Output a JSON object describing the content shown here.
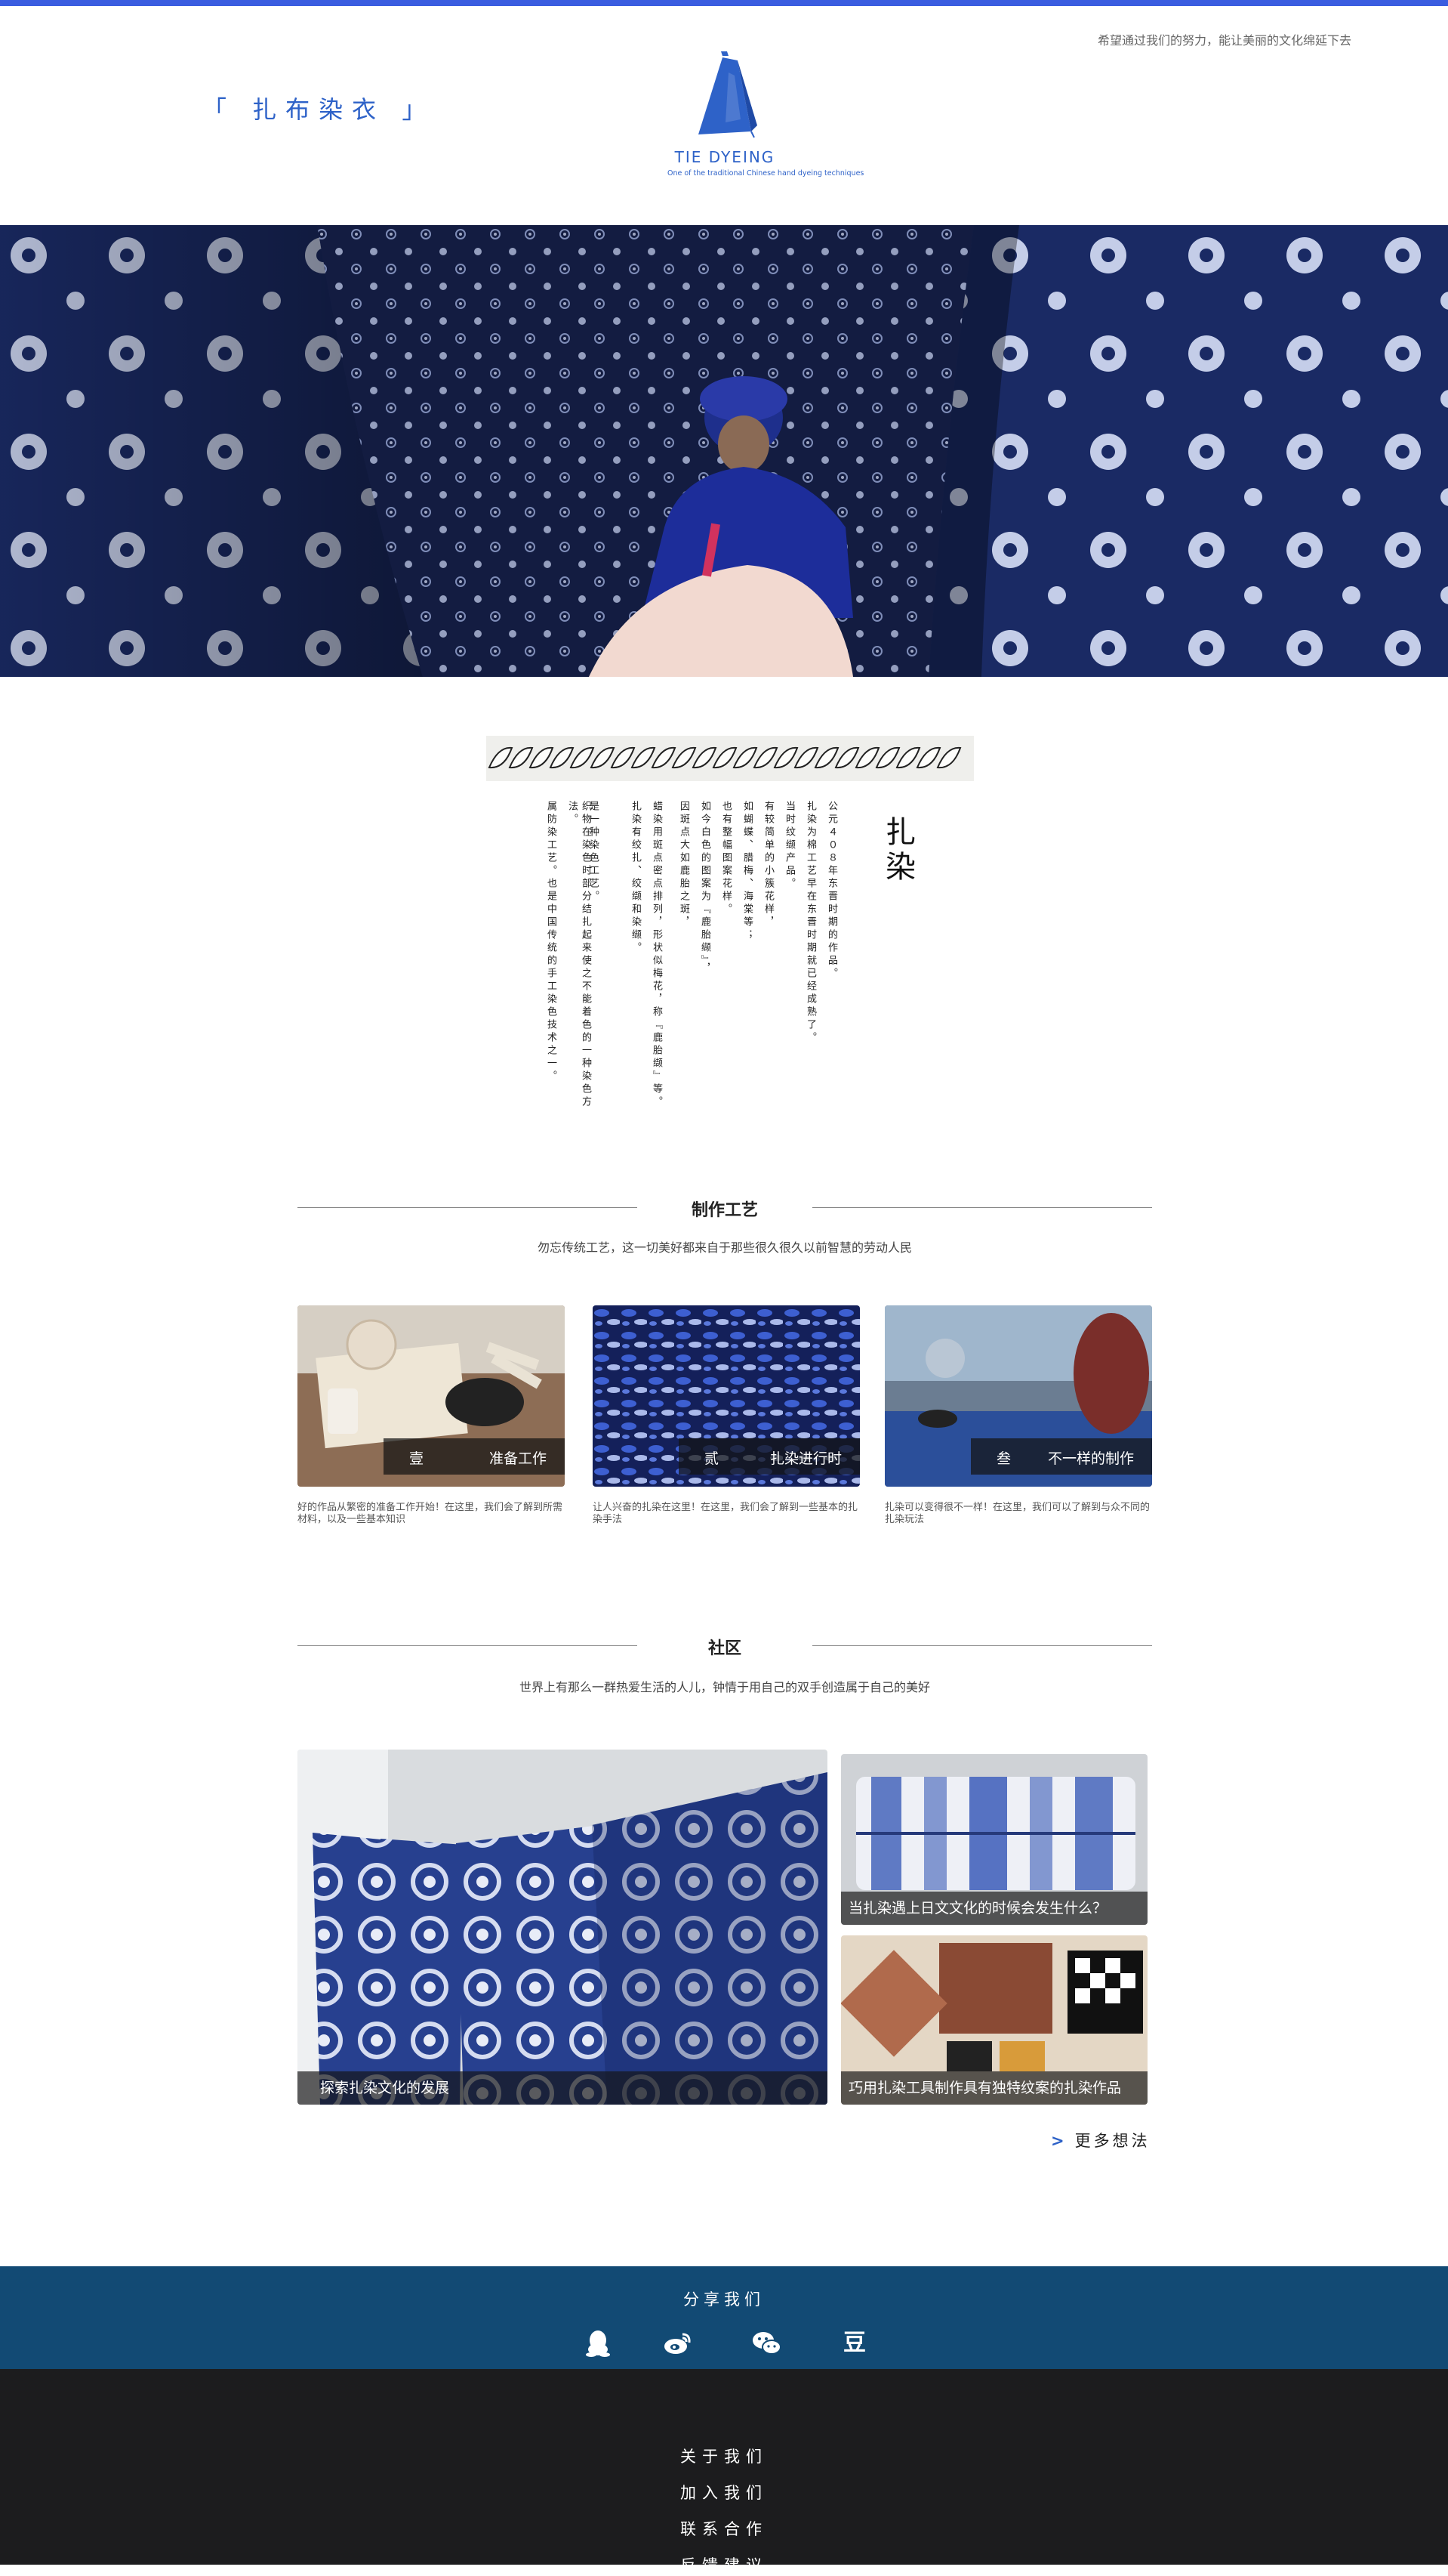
{
  "header": {
    "brand_left": "「 扎布染衣 」",
    "tagline": "希望通过我们的努力，能让美丽的文化绵延下去",
    "logo_title": "TIE DYEING",
    "logo_subtitle": "One of the traditional Chinese hand dyeing techniques",
    "accent_color": "#2e62c8"
  },
  "poem": {
    "title": "扎染",
    "columns": [
      "公元４０８年东晋时期的作品。",
      "扎染为棉工艺早在东晋时期就已经成熟了。",
      "当时纹缬产品。",
      "有较简单的小簇花样，",
      "如蝴蝶、腊梅、海棠等；",
      "也有整幅图案花样。",
      "如今白色的图案为『鹿胎缬』，",
      "因斑点大如鹿胎之斑，",
      "蜡染用斑点密点排列，形状似梅花，称『鹿胎缬』等。",
      "扎染有绞扎、绞缬和染缬。",
      "是一种染色工艺。",
      "织物在染色时部分结扎起来使之不能着色的一种染色方法。",
      "属防染工艺。也是中国传统的手工染色技术之一。"
    ]
  },
  "process": {
    "title": "制作工艺",
    "subtitle": "勿忘传统工艺，这一切美好都来自于那些很久很久以前智慧的劳动人民",
    "cards": [
      {
        "num": "壹",
        "name": "准备工作",
        "desc": "好的作品从繁密的准备工作开始！在这里，我们会了解到所需材料，以及一些基本知识"
      },
      {
        "num": "贰",
        "name": "扎染进行时",
        "desc": "让人兴奋的扎染在这里！在这里，我们会了解到一些基本的扎染手法"
      },
      {
        "num": "叁",
        "name": "不一样的制作",
        "desc": "扎染可以变得很不一样！在这里，我们可以了解到与众不同的扎染玩法"
      }
    ]
  },
  "community": {
    "title": "社区",
    "subtitle": "世界上有那么一群热爱生活的人儿，钟情于用自己的双手创造属于自己的美好",
    "posts": [
      {
        "caption": "探索扎染文化的发展"
      },
      {
        "caption": "当扎染遇上日文文化的时候会发生什么？"
      },
      {
        "caption": "巧用扎染工具制作具有独特纹案的扎染作品"
      }
    ],
    "more_label": "更多想法",
    "more_arrow": ">"
  },
  "share": {
    "title": "分享我们",
    "icons": [
      "qq-icon",
      "weibo-icon",
      "wechat-icon",
      "douban-icon"
    ],
    "douban_glyph": "豆",
    "band_color": "#124a74"
  },
  "footer": {
    "links": [
      "关于我们",
      "加入我们",
      "联系合作",
      "反馈建议"
    ],
    "bg_color": "#1c1c1e"
  }
}
